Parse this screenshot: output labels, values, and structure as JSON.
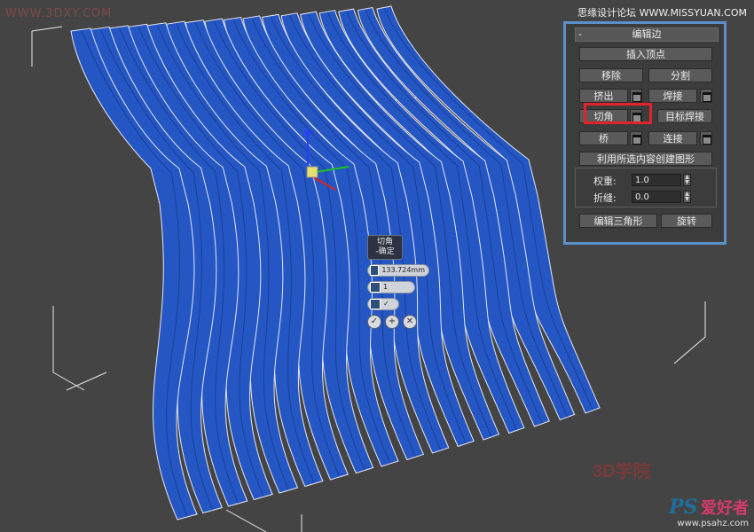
{
  "watermarks": {
    "top_left": "WWW.3DXY.COM",
    "top_right": "思缘设计论坛  WWW.MISSYUAN.COM",
    "bottom_logo": "3D学院",
    "bottom_brand_ps": "PS",
    "bottom_brand_cn": "爱好者",
    "bottom_url": "www.psahz.com"
  },
  "caddy": {
    "title_line1": "切角",
    "title_line2": "-确定",
    "amount_value": "133.724mm",
    "segments_value": "1",
    "ok_icon": "check-icon",
    "apply_icon": "plus-icon",
    "cancel_icon": "cross-icon"
  },
  "panel": {
    "rollout_title": "编辑边",
    "collapse_symbol": "-",
    "insert_vertex": "插入顶点",
    "remove": "移除",
    "split": "分割",
    "extrude": "挤出",
    "weld": "焊接",
    "chamfer": "切角",
    "target_weld": "目标焊接",
    "bridge": "桥",
    "connect": "连接",
    "create_shape": "利用所选内容创建图形",
    "weight_label": "权重:",
    "weight_value": "1.0",
    "crease_label": "折缝:",
    "crease_value": "0.0",
    "edit_tri": "编辑三角形",
    "turn": "旋转"
  },
  "colors": {
    "viewport_bg": "#444444",
    "mesh_blue": "#2456c4",
    "panel_border": "#5b90c8",
    "highlight_red": "#e0242a"
  }
}
